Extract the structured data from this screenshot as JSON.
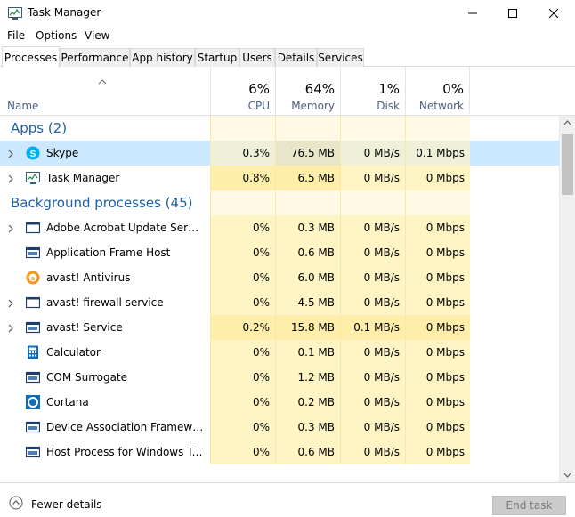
{
  "window": {
    "title": "Task Manager"
  },
  "menu": [
    "File",
    "Options",
    "View"
  ],
  "tabs": [
    "Processes",
    "Performance",
    "App history",
    "Startup",
    "Users",
    "Details",
    "Services"
  ],
  "columns": {
    "name": "Name",
    "cpu": {
      "pct": "6%",
      "label": "CPU"
    },
    "memory": {
      "pct": "64%",
      "label": "Memory"
    },
    "disk": {
      "pct": "1%",
      "label": "Disk"
    },
    "network": {
      "pct": "0%",
      "label": "Network"
    }
  },
  "groups": {
    "apps": "Apps (2)",
    "background": "Background processes (45)"
  },
  "apps": [
    {
      "name": "Skype",
      "icon": "skype-icon",
      "cpu": "0.3%",
      "mem": "76.5 MB",
      "disk": "0 MB/s",
      "net": "0.1 Mbps",
      "expandable": true,
      "selected": true
    },
    {
      "name": "Task Manager",
      "icon": "task-manager-icon",
      "cpu": "0.8%",
      "mem": "6.5 MB",
      "disk": "0 MB/s",
      "net": "0 Mbps",
      "expandable": true
    }
  ],
  "background": [
    {
      "name": "Adobe Acrobat Update Service",
      "icon": "window-icon",
      "cpu": "0%",
      "mem": "0.3 MB",
      "disk": "0 MB/s",
      "net": "0 Mbps",
      "expandable": true
    },
    {
      "name": "Application Frame Host",
      "icon": "service-icon",
      "cpu": "0%",
      "mem": "0.6 MB",
      "disk": "0 MB/s",
      "net": "0 Mbps",
      "expandable": false
    },
    {
      "name": "avast! Antivirus",
      "icon": "avast-icon",
      "cpu": "0%",
      "mem": "6.0 MB",
      "disk": "0 MB/s",
      "net": "0 Mbps",
      "expandable": false
    },
    {
      "name": "avast! firewall service",
      "icon": "window-icon",
      "cpu": "0%",
      "mem": "4.5 MB",
      "disk": "0 MB/s",
      "net": "0 Mbps",
      "expandable": true
    },
    {
      "name": "avast! Service",
      "icon": "service-icon",
      "cpu": "0.2%",
      "mem": "15.8 MB",
      "disk": "0.1 MB/s",
      "net": "0 Mbps",
      "expandable": true,
      "hot": true
    },
    {
      "name": "Calculator",
      "icon": "calculator-icon",
      "cpu": "0%",
      "mem": "0.1 MB",
      "disk": "0 MB/s",
      "net": "0 Mbps",
      "expandable": false
    },
    {
      "name": "COM Surrogate",
      "icon": "service-icon",
      "cpu": "0%",
      "mem": "1.2 MB",
      "disk": "0 MB/s",
      "net": "0 Mbps",
      "expandable": false
    },
    {
      "name": "Cortana",
      "icon": "cortana-icon",
      "cpu": "0%",
      "mem": "0.2 MB",
      "disk": "0 MB/s",
      "net": "0 Mbps",
      "expandable": false
    },
    {
      "name": "Device Association Framework ...",
      "icon": "service-icon",
      "cpu": "0%",
      "mem": "0.3 MB",
      "disk": "0 MB/s",
      "net": "0 Mbps",
      "expandable": false
    },
    {
      "name": "Host Process for Windows Tasks",
      "icon": "service-icon",
      "cpu": "0%",
      "mem": "0.6 MB",
      "disk": "0 MB/s",
      "net": "0 Mbps",
      "expandable": false
    }
  ],
  "footer": {
    "fewer_details": "Fewer details",
    "end_task": "End task"
  },
  "colors": {
    "heat_light": "#fff4c4",
    "heat_medium": "#ffeeaa",
    "selected": "#cce8ff",
    "group_title": "#1e5fa8"
  }
}
